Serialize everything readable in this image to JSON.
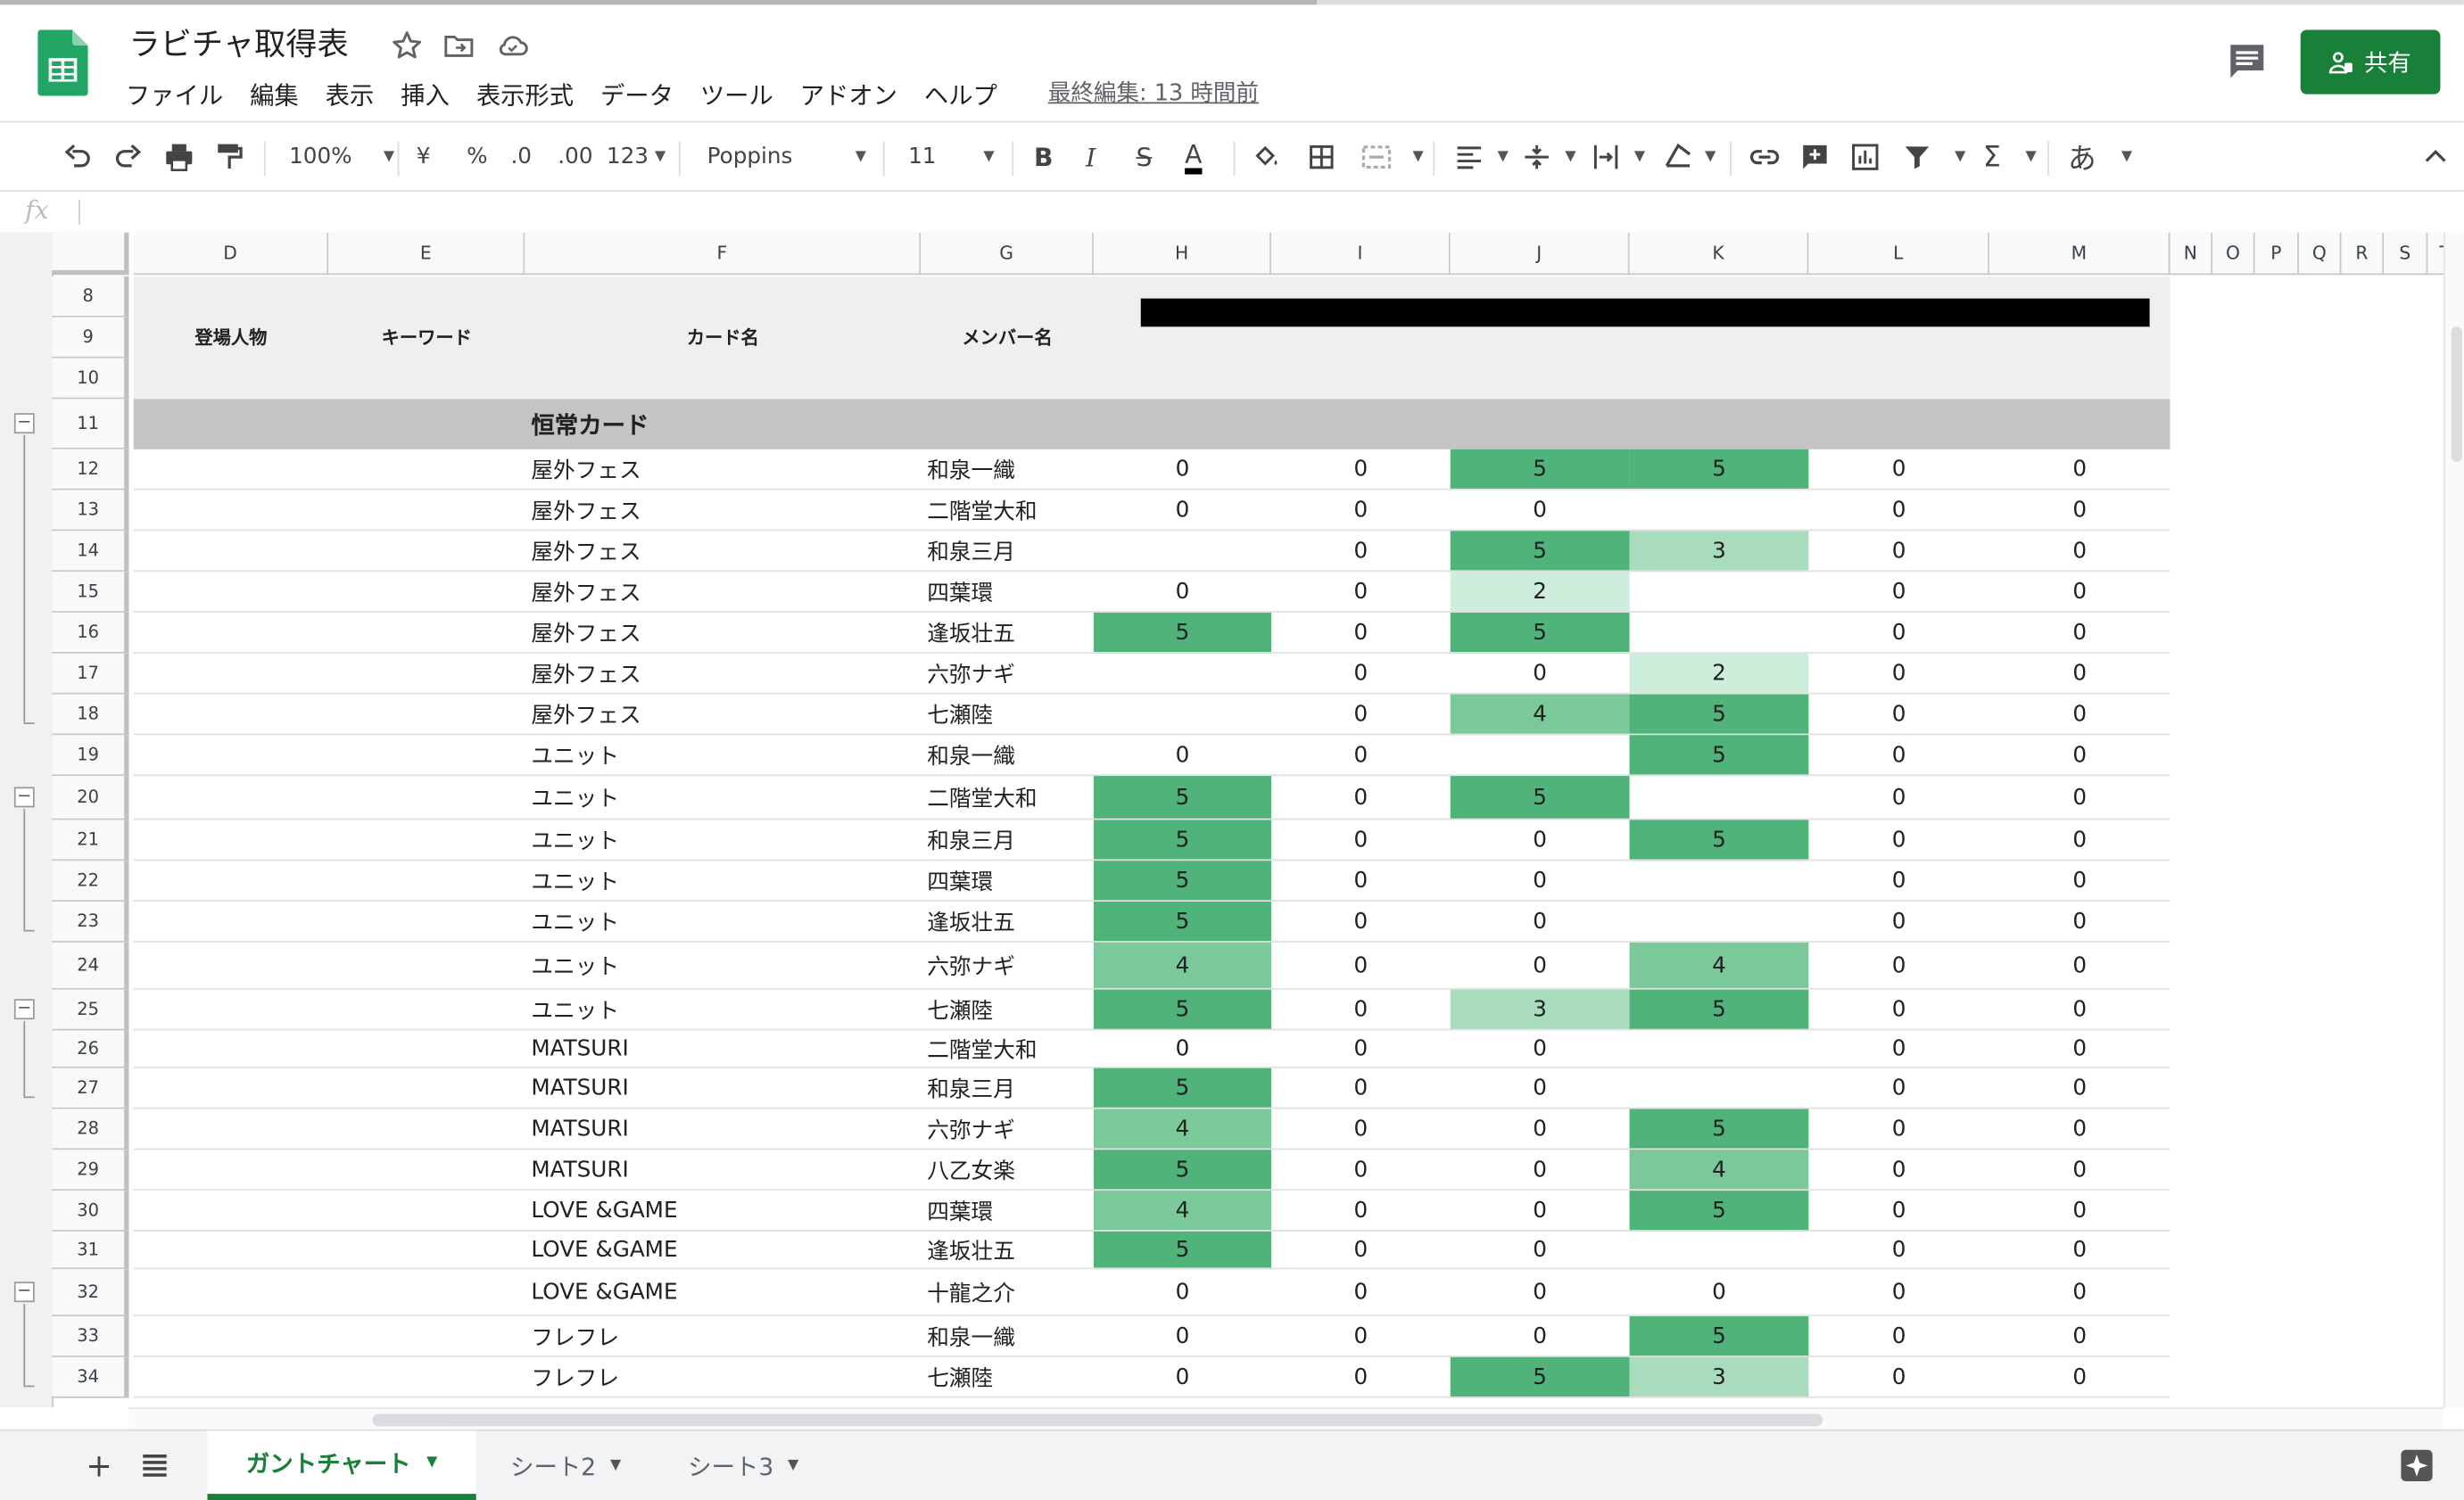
{
  "app": {
    "doc_title": "ラビチャ取得表",
    "last_edit": "最終編集: 13 時間前",
    "share_label": "共有",
    "menu": [
      "ファイル",
      "編集",
      "表示",
      "挿入",
      "表示形式",
      "データ",
      "ツール",
      "アドオン",
      "ヘルプ"
    ]
  },
  "toolbar": {
    "zoom": "100%",
    "currency": "¥",
    "percent": "%",
    "dec_less": ".0",
    "dec_more": ".00",
    "number_format": "123",
    "font": "Poppins",
    "font_size": "11",
    "bold": "B",
    "italic": "I",
    "strike": "S",
    "text_color": "A",
    "sigma": "Σ",
    "input_tool": "あ"
  },
  "formula_bar": {
    "fx": "fx",
    "value": ""
  },
  "columns": [
    {
      "id": "D",
      "label": "D"
    },
    {
      "id": "E",
      "label": "E"
    },
    {
      "id": "F",
      "label": "F"
    },
    {
      "id": "G",
      "label": "G"
    },
    {
      "id": "H",
      "label": "H"
    },
    {
      "id": "I",
      "label": "I"
    },
    {
      "id": "J",
      "label": "J"
    },
    {
      "id": "K",
      "label": "K"
    },
    {
      "id": "L",
      "label": "L"
    },
    {
      "id": "M",
      "label": "M"
    },
    {
      "id": "N",
      "label": "N"
    },
    {
      "id": "O",
      "label": "O"
    },
    {
      "id": "P",
      "label": "P"
    },
    {
      "id": "Q",
      "label": "Q"
    },
    {
      "id": "R",
      "label": "R"
    },
    {
      "id": "S",
      "label": "S"
    },
    {
      "id": "T",
      "label": "T"
    }
  ],
  "header_labels": {
    "character": "登場人物",
    "keyword": "キーワード",
    "card_name": "カード名",
    "member_name": "メンバー名"
  },
  "section_title": "恒常カード",
  "colors": {
    "dark_green": "#4fb37a",
    "mid_green": "#7bc99a",
    "light_green": "#a8dcbc",
    "pale_green": "#cdeedb",
    "header_gray": "#c4c4c4",
    "panel_gray": "#efefef",
    "brand_green": "#188038"
  },
  "rows": [
    {
      "row": "8"
    },
    {
      "row": "9"
    },
    {
      "row": "10"
    },
    {
      "row": "11"
    },
    {
      "row": "12",
      "card": "屋外フェス",
      "member": "和泉一織",
      "H": "0",
      "I": "0",
      "J": "5",
      "K": "5",
      "L": "0",
      "M": "0",
      "shade": {
        "J": "dark",
        "K": "dark"
      }
    },
    {
      "row": "13",
      "card": "屋外フェス",
      "member": "二階堂大和",
      "H": "0",
      "I": "0",
      "J": "0",
      "K": "",
      "L": "0",
      "M": "0",
      "shade": {}
    },
    {
      "row": "14",
      "card": "屋外フェス",
      "member": "和泉三月",
      "H": "",
      "I": "0",
      "J": "5",
      "K": "3",
      "L": "0",
      "M": "0",
      "shade": {
        "J": "dark",
        "K": "light"
      }
    },
    {
      "row": "15",
      "card": "屋外フェス",
      "member": "四葉環",
      "H": "0",
      "I": "0",
      "J": "2",
      "K": "",
      "L": "0",
      "M": "0",
      "shade": {
        "J": "pale"
      }
    },
    {
      "row": "16",
      "card": "屋外フェス",
      "member": "逢坂壮五",
      "H": "5",
      "I": "0",
      "J": "5",
      "K": "",
      "L": "0",
      "M": "0",
      "shade": {
        "H": "dark",
        "J": "dark"
      }
    },
    {
      "row": "17",
      "card": "屋外フェス",
      "member": "六弥ナギ",
      "H": "",
      "I": "0",
      "J": "0",
      "K": "2",
      "L": "0",
      "M": "0",
      "shade": {
        "K": "pale"
      }
    },
    {
      "row": "18",
      "card": "屋外フェス",
      "member": "七瀬陸",
      "H": "",
      "I": "0",
      "J": "4",
      "K": "5",
      "L": "0",
      "M": "0",
      "shade": {
        "J": "mid",
        "K": "dark"
      }
    },
    {
      "row": "19",
      "card": "ユニット",
      "member": "和泉一織",
      "H": "0",
      "I": "0",
      "J": "",
      "K": "5",
      "L": "0",
      "M": "0",
      "shade": {
        "K": "dark"
      }
    },
    {
      "row": "20",
      "card": "ユニット",
      "member": "二階堂大和",
      "H": "5",
      "I": "0",
      "J": "5",
      "K": "",
      "L": "0",
      "M": "0",
      "shade": {
        "H": "dark",
        "J": "dark"
      }
    },
    {
      "row": "21",
      "card": "ユニット",
      "member": "和泉三月",
      "H": "5",
      "I": "0",
      "J": "0",
      "K": "5",
      "L": "0",
      "M": "0",
      "shade": {
        "H": "dark",
        "K": "dark"
      }
    },
    {
      "row": "22",
      "card": "ユニット",
      "member": "四葉環",
      "H": "5",
      "I": "0",
      "J": "0",
      "K": "",
      "L": "0",
      "M": "0",
      "shade": {
        "H": "dark"
      }
    },
    {
      "row": "23",
      "card": "ユニット",
      "member": "逢坂壮五",
      "H": "5",
      "I": "0",
      "J": "0",
      "K": "",
      "L": "0",
      "M": "0",
      "shade": {
        "H": "dark"
      }
    },
    {
      "row": "24",
      "card": "ユニット",
      "member": "六弥ナギ",
      "H": "4",
      "I": "0",
      "J": "0",
      "K": "4",
      "L": "0",
      "M": "0",
      "shade": {
        "H": "mid",
        "K": "mid"
      }
    },
    {
      "row": "25",
      "card": "ユニット",
      "member": "七瀬陸",
      "H": "5",
      "I": "0",
      "J": "3",
      "K": "5",
      "L": "0",
      "M": "0",
      "shade": {
        "H": "dark",
        "J": "light",
        "K": "dark"
      }
    },
    {
      "row": "26",
      "card": "MATSURI",
      "member": "二階堂大和",
      "H": "0",
      "I": "0",
      "J": "0",
      "K": "",
      "L": "0",
      "M": "0",
      "shade": {}
    },
    {
      "row": "27",
      "card": "MATSURI",
      "member": "和泉三月",
      "H": "5",
      "I": "0",
      "J": "0",
      "K": "",
      "L": "0",
      "M": "0",
      "shade": {
        "H": "dark"
      }
    },
    {
      "row": "28",
      "card": "MATSURI",
      "member": "六弥ナギ",
      "H": "4",
      "I": "0",
      "J": "0",
      "K": "5",
      "L": "0",
      "M": "0",
      "shade": {
        "H": "mid",
        "K": "dark"
      }
    },
    {
      "row": "29",
      "card": "MATSURI",
      "member": "八乙女楽",
      "H": "5",
      "I": "0",
      "J": "0",
      "K": "4",
      "L": "0",
      "M": "0",
      "shade": {
        "H": "dark",
        "K": "mid"
      }
    },
    {
      "row": "30",
      "card": "LOVE &GAME",
      "member": "四葉環",
      "H": "4",
      "I": "0",
      "J": "0",
      "K": "5",
      "L": "0",
      "M": "0",
      "shade": {
        "H": "mid",
        "K": "dark"
      }
    },
    {
      "row": "31",
      "card": "LOVE &GAME",
      "member": "逢坂壮五",
      "H": "5",
      "I": "0",
      "J": "0",
      "K": "",
      "L": "0",
      "M": "0",
      "shade": {
        "H": "dark"
      }
    },
    {
      "row": "32",
      "card": "LOVE &GAME",
      "member": "十龍之介",
      "H": "0",
      "I": "0",
      "J": "0",
      "K": "0",
      "L": "0",
      "M": "0",
      "shade": {}
    },
    {
      "row": "33",
      "card": "フレフレ",
      "member": "和泉一織",
      "H": "0",
      "I": "0",
      "J": "0",
      "K": "5",
      "L": "0",
      "M": "0",
      "shade": {
        "K": "dark"
      }
    },
    {
      "row": "34",
      "card": "フレフレ",
      "member": "七瀬陸",
      "H": "0",
      "I": "0",
      "J": "5",
      "K": "3",
      "L": "0",
      "M": "0",
      "shade": {
        "J": "dark",
        "K": "light"
      }
    }
  ],
  "sheet_tabs": [
    {
      "label": "ガントチャート",
      "active": true
    },
    {
      "label": "シート2",
      "active": false
    },
    {
      "label": "シート3",
      "active": false
    }
  ]
}
